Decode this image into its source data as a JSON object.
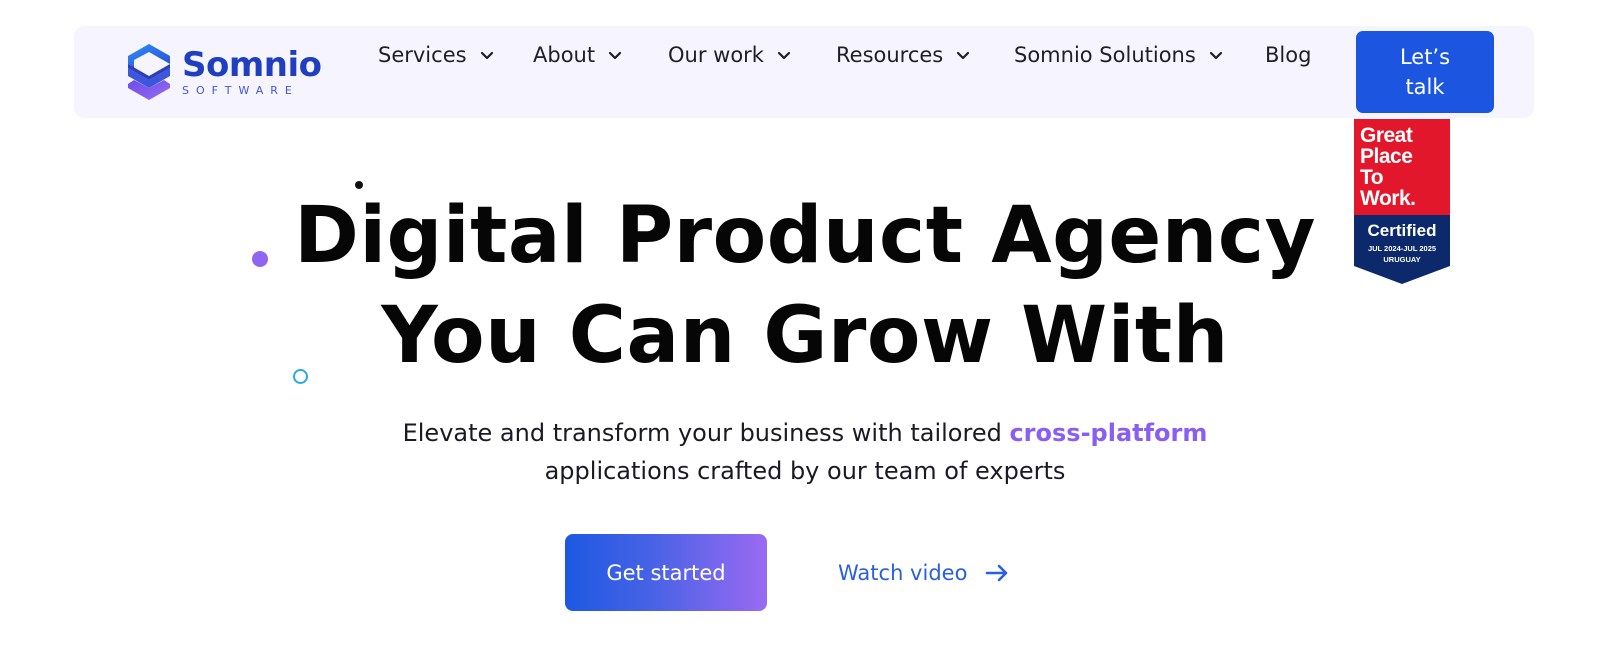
{
  "brand": {
    "name": "Somnio",
    "sub": "SOFTWARE",
    "logo_icon": "somnio-s-logo-icon"
  },
  "nav": {
    "items": [
      {
        "label": "Services",
        "has_dropdown": true
      },
      {
        "label": "About",
        "has_dropdown": true
      },
      {
        "label": "Our work",
        "has_dropdown": true
      },
      {
        "label": "Resources",
        "has_dropdown": true
      },
      {
        "label": "Somnio Solutions",
        "has_dropdown": true
      },
      {
        "label": "Blog",
        "has_dropdown": false
      }
    ],
    "cta_line1": "Let’s",
    "cta_line2": "talk"
  },
  "badge": {
    "line1": "Great",
    "line2": "Place",
    "line3": "To",
    "line4": "Work.",
    "certified": "Certified",
    "dates": "JUL 2024-JUL 2025",
    "country": "URUGUAY"
  },
  "hero": {
    "headline_line1": "Digital Product Agency",
    "headline_line2": "You Can Grow With",
    "subtitle_pre": "Elevate and transform your business with tailored ",
    "subtitle_accent": "cross-platform",
    "subtitle_post": "applications crafted by our team of experts",
    "primary_button": "Get started",
    "secondary_button": "Watch video"
  },
  "colors": {
    "brand_blue": "#1c55e0",
    "accent_purple": "#8a5ef2",
    "nav_bg": "#f6f4fe",
    "badge_red": "#e3172b",
    "badge_navy": "#0c2a6b"
  }
}
